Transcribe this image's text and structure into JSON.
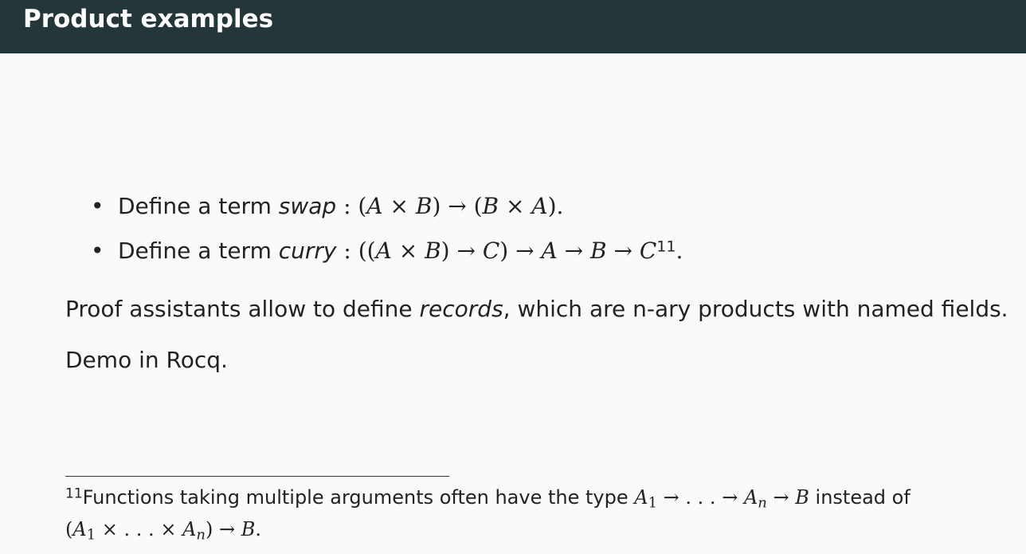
{
  "slide": {
    "title": "Product examples",
    "bullets": [
      {
        "prefix": "Define a term ",
        "name": "swap",
        "type_prefix": " : (",
        "A": "A",
        "times": " × ",
        "B": "B",
        "arrow": ") → (",
        "B2": "B",
        "times2": " × ",
        "A2": "A",
        "suffix": ")."
      },
      {
        "prefix": "Define a term ",
        "name": "curry",
        "open": " : ((",
        "A": "A",
        "times": " × ",
        "B": "B",
        "mid1": ") → ",
        "C": "C",
        "mid2": ") → ",
        "A2": "A",
        "arrow3": " → ",
        "B2": "B",
        "arrow4": " → ",
        "C2": "C",
        "footnote_ref": "11",
        "suffix": "."
      }
    ],
    "paragraph1": {
      "before": "Proof assistants allow to define ",
      "emph": "records",
      "after": ", which are n-ary products with named fields."
    },
    "paragraph2": "Demo in Rocq.",
    "footnote": {
      "number": "11",
      "line1_text": "Functions taking multiple arguments often have the type ",
      "line1_math": {
        "A1": "A",
        "sub1": "1",
        "seq": " → . . . → ",
        "An": "A",
        "subn": "n",
        "arrow": " → ",
        "B": "B"
      },
      "line1_after": " instead of",
      "line2_math": {
        "open": "(",
        "A1": "A",
        "sub1": "1",
        "seq": " × . . . × ",
        "An": "A",
        "subn": "n",
        "close": ") → ",
        "B": "B",
        "end": "."
      }
    }
  }
}
